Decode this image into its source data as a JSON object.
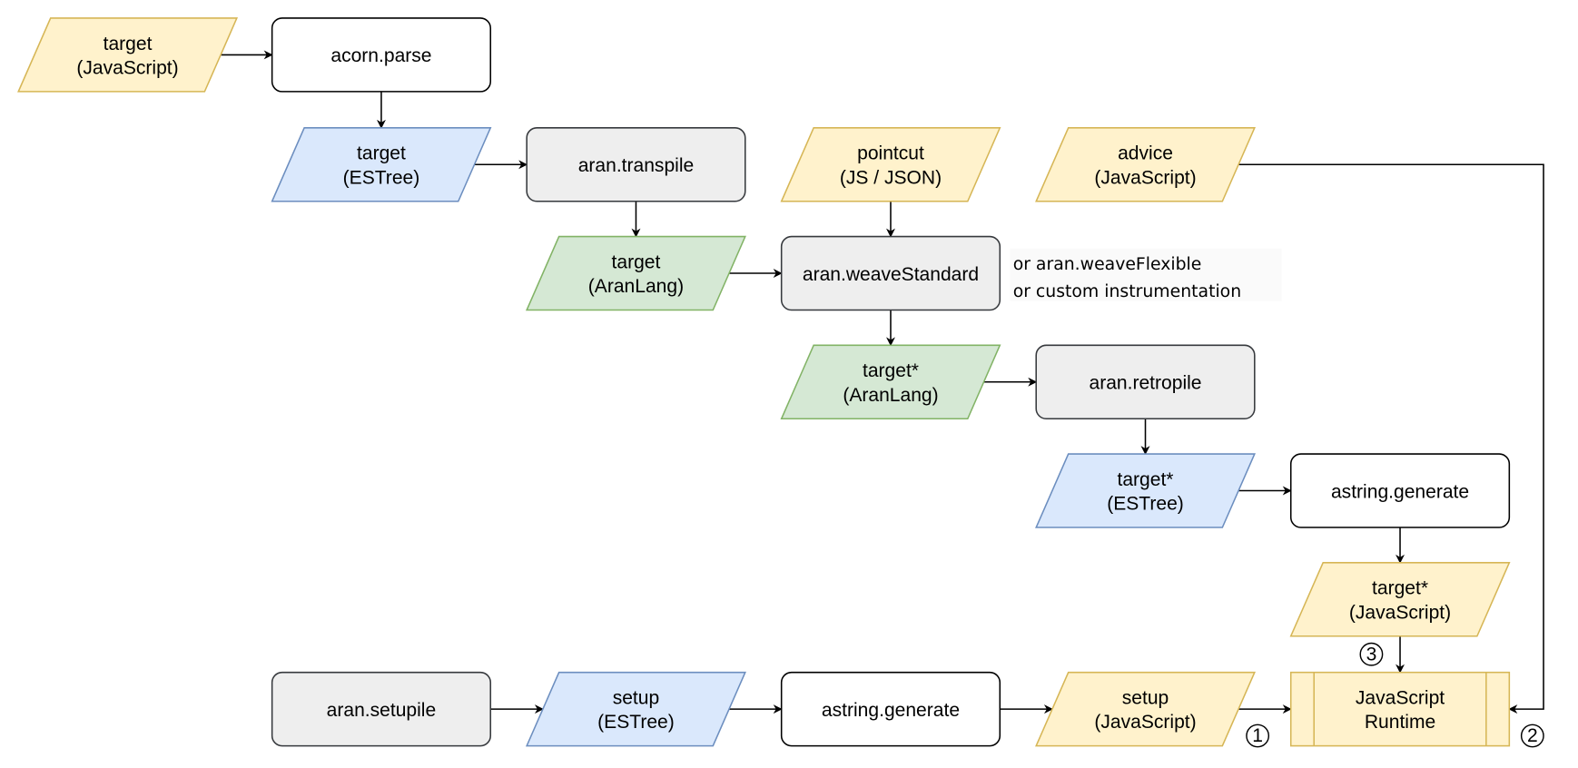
{
  "colors": {
    "yellow_fill": "#fff2cc",
    "yellow_stroke": "#d6b656",
    "blue_fill": "#dae8fc",
    "blue_stroke": "#6c8ebf",
    "green_fill": "#d5e8d4",
    "green_stroke": "#82b366",
    "gray_fill": "#eeeeee",
    "gray_stroke": "#36393d",
    "white_fill": "#ffffff",
    "white_stroke": "#000000"
  },
  "nodes": {
    "target_js": {
      "lines": [
        "target",
        "(JavaScript)"
      ],
      "shape": "data",
      "color": "yellow"
    },
    "acorn_parse": {
      "lines": [
        "acorn.parse"
      ],
      "shape": "process",
      "color": "white"
    },
    "target_estree": {
      "lines": [
        "target",
        "(ESTree)"
      ],
      "shape": "data",
      "color": "blue"
    },
    "aran_transpile": {
      "lines": [
        "aran.transpile"
      ],
      "shape": "process",
      "color": "gray"
    },
    "pointcut": {
      "lines": [
        "pointcut",
        "(JS / JSON)"
      ],
      "shape": "data",
      "color": "yellow"
    },
    "advice": {
      "lines": [
        "advice",
        "(JavaScript)"
      ],
      "shape": "data",
      "color": "yellow"
    },
    "target_aranlang": {
      "lines": [
        "target",
        "(AranLang)"
      ],
      "shape": "data",
      "color": "green"
    },
    "aran_weave": {
      "lines": [
        "aran.weaveStandard"
      ],
      "shape": "process",
      "color": "gray"
    },
    "target_star_aranlang": {
      "lines": [
        "target*",
        "(AranLang)"
      ],
      "shape": "data",
      "color": "green"
    },
    "aran_retropile": {
      "lines": [
        "aran.retropile"
      ],
      "shape": "process",
      "color": "gray"
    },
    "target_star_estree": {
      "lines": [
        "target*",
        "(ESTree)"
      ],
      "shape": "data",
      "color": "blue"
    },
    "astring_generate_1": {
      "lines": [
        "astring.generate"
      ],
      "shape": "process",
      "color": "white"
    },
    "target_star_js": {
      "lines": [
        "target*",
        "(JavaScript)"
      ],
      "shape": "data",
      "color": "yellow"
    },
    "js_runtime": {
      "lines": [
        "JavaScript",
        "Runtime"
      ],
      "shape": "subprocess",
      "color": "yellow"
    },
    "aran_setupile": {
      "lines": [
        "aran.setupile"
      ],
      "shape": "process",
      "color": "gray"
    },
    "setup_estree": {
      "lines": [
        "setup",
        "(ESTree)"
      ],
      "shape": "data",
      "color": "blue"
    },
    "astring_generate_2": {
      "lines": [
        "astring.generate"
      ],
      "shape": "process",
      "color": "white"
    },
    "setup_js": {
      "lines": [
        "setup",
        "(JavaScript)"
      ],
      "shape": "data",
      "color": "yellow"
    }
  },
  "edges": [
    [
      "target_js",
      "acorn_parse"
    ],
    [
      "acorn_parse",
      "target_estree"
    ],
    [
      "target_estree",
      "aran_transpile"
    ],
    [
      "aran_transpile",
      "target_aranlang"
    ],
    [
      "pointcut",
      "aran_weave"
    ],
    [
      "target_aranlang",
      "aran_weave"
    ],
    [
      "aran_weave",
      "target_star_aranlang"
    ],
    [
      "target_star_aranlang",
      "aran_retropile"
    ],
    [
      "aran_retropile",
      "target_star_estree"
    ],
    [
      "target_star_estree",
      "astring_generate_1"
    ],
    [
      "astring_generate_1",
      "target_star_js"
    ],
    [
      "target_star_js",
      "js_runtime"
    ],
    [
      "advice",
      "js_runtime"
    ],
    [
      "aran_setupile",
      "setup_estree"
    ],
    [
      "setup_estree",
      "astring_generate_2"
    ],
    [
      "astring_generate_2",
      "setup_js"
    ],
    [
      "setup_js",
      "js_runtime"
    ]
  ],
  "note": {
    "lines": [
      "or aran.weaveFlexible",
      "or custom instrumentation"
    ]
  },
  "badges": {
    "setup": "1",
    "advice": "2",
    "target": "3"
  }
}
